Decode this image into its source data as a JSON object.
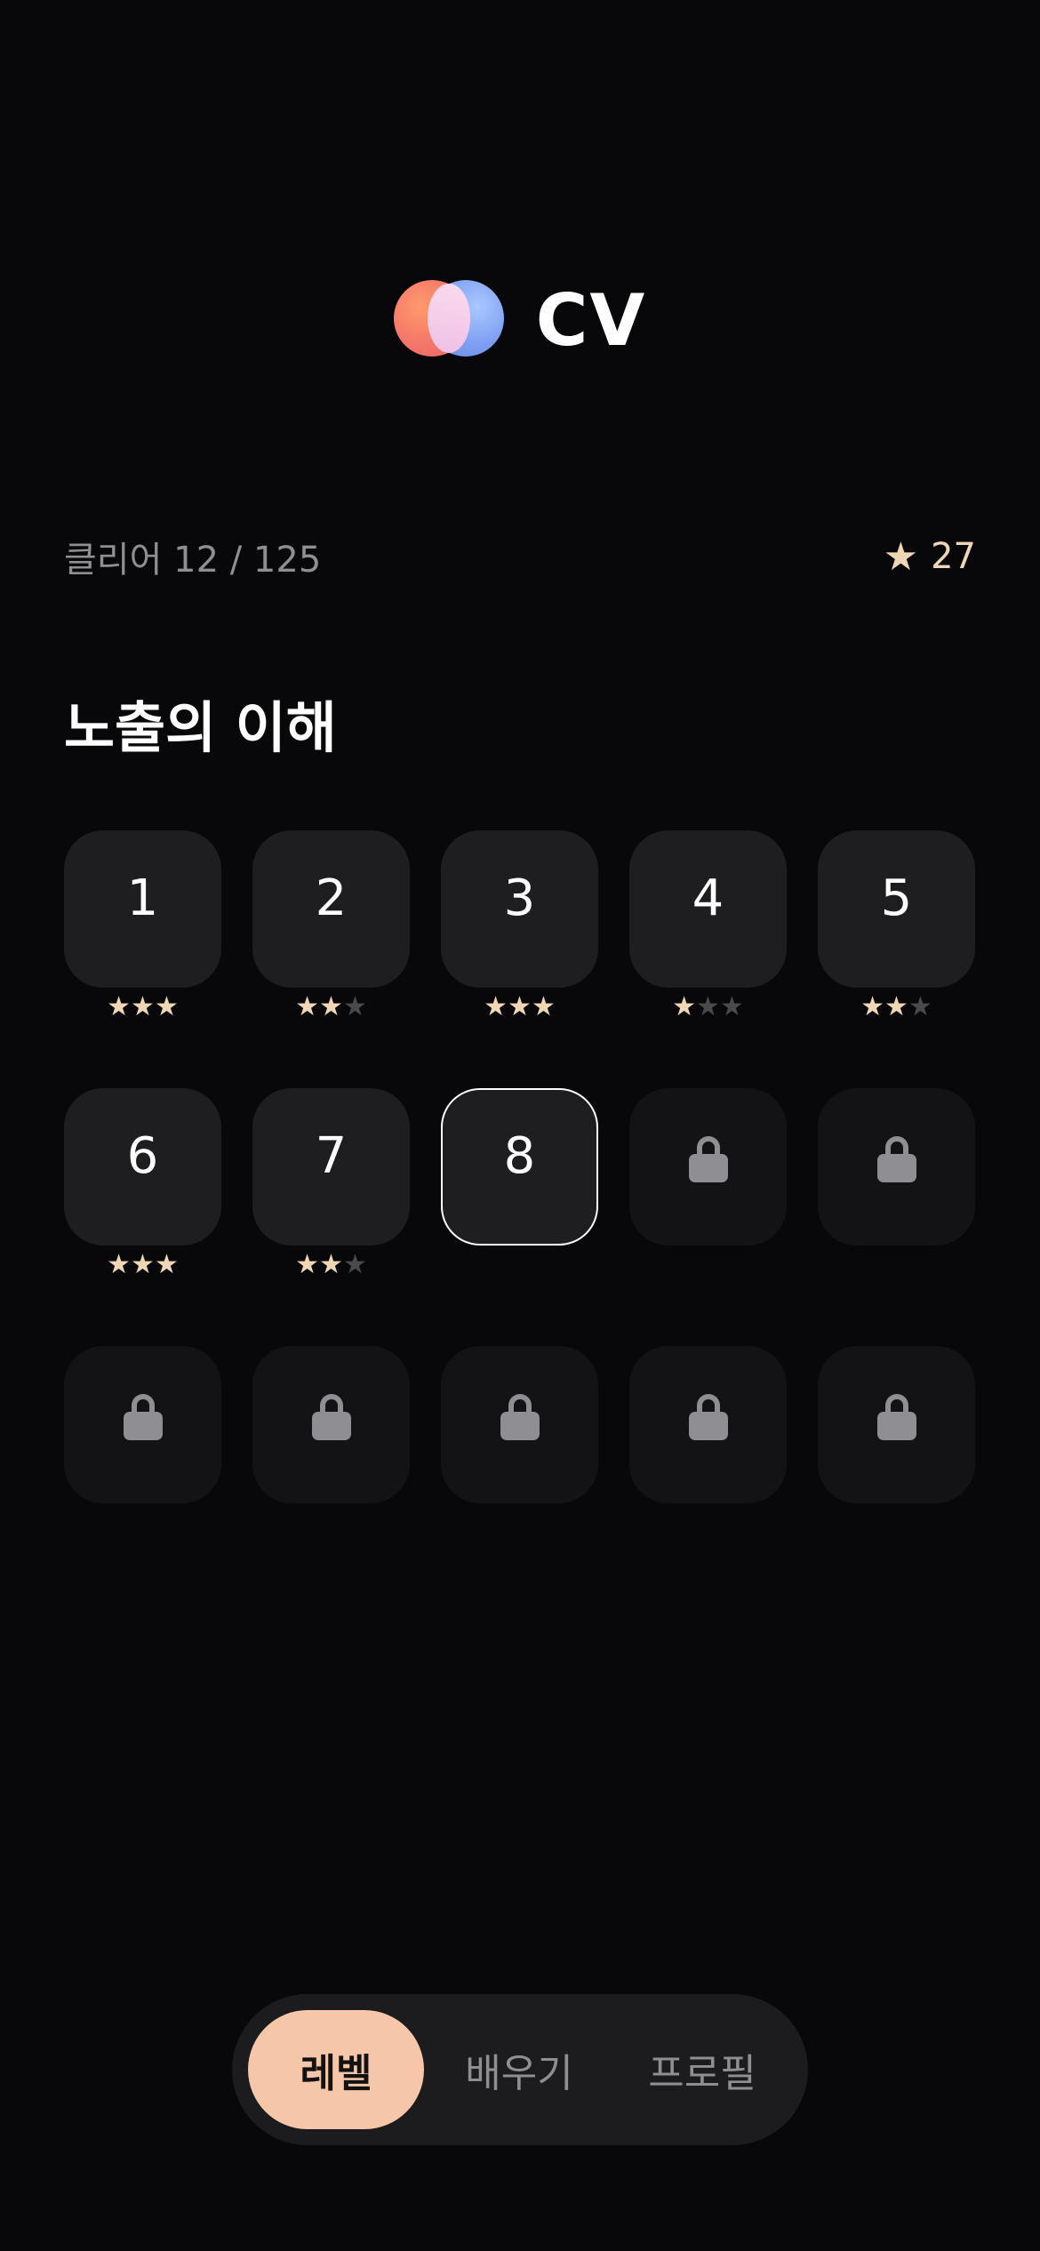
{
  "app": {
    "logo_text": "CV",
    "brand_colors": {
      "left": "#f4756a",
      "right": "#7d9ef2",
      "accent": "#efd7b6",
      "active_tab": "#f6c6a8"
    }
  },
  "progress": {
    "clear_label": "클리어 12 / 125",
    "star_icon": "star-icon",
    "star_total": "27"
  },
  "section": {
    "title": "노출의 이해"
  },
  "levels": [
    {
      "label": "1",
      "state": "cleared",
      "stars": 3
    },
    {
      "label": "2",
      "state": "cleared",
      "stars": 2
    },
    {
      "label": "3",
      "state": "cleared",
      "stars": 3
    },
    {
      "label": "4",
      "state": "cleared",
      "stars": 1
    },
    {
      "label": "5",
      "state": "cleared",
      "stars": 2
    },
    {
      "label": "6",
      "state": "cleared",
      "stars": 3
    },
    {
      "label": "7",
      "state": "cleared",
      "stars": 2
    },
    {
      "label": "8",
      "state": "current",
      "stars": 0
    },
    {
      "label": "",
      "state": "locked",
      "stars": 0
    },
    {
      "label": "",
      "state": "locked",
      "stars": 0
    },
    {
      "label": "",
      "state": "locked",
      "stars": 0
    },
    {
      "label": "",
      "state": "locked",
      "stars": 0
    },
    {
      "label": "",
      "state": "locked",
      "stars": 0
    },
    {
      "label": "",
      "state": "locked",
      "stars": 0
    },
    {
      "label": "",
      "state": "locked",
      "stars": 0
    }
  ],
  "tabs": [
    {
      "label": "레벨",
      "active": true
    },
    {
      "label": "배우기",
      "active": false
    },
    {
      "label": "프로필",
      "active": false
    }
  ]
}
